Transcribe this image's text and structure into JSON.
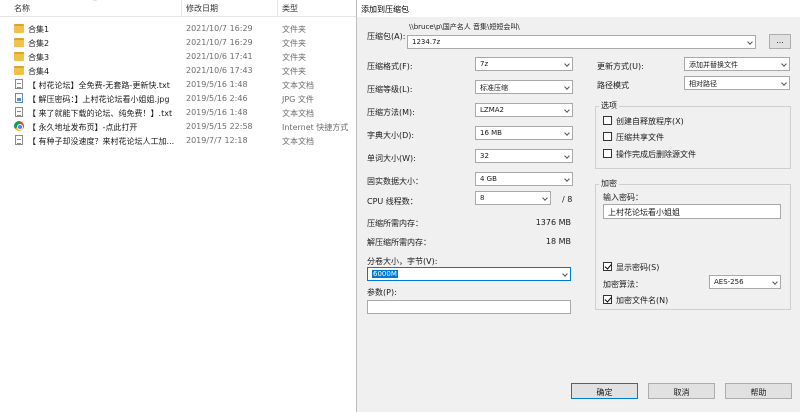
{
  "explorer": {
    "columns": {
      "name": "名称",
      "date": "修改日期",
      "type": "类型"
    },
    "files": [
      {
        "icon": "folder-icon",
        "name": "合集1",
        "date": "2021/10/7 16:29",
        "type": "文件夹"
      },
      {
        "icon": "folder-icon",
        "name": "合集2",
        "date": "2021/10/7 16:29",
        "type": "文件夹"
      },
      {
        "icon": "folder-icon",
        "name": "合集3",
        "date": "2021/10/6 17:41",
        "type": "文件夹"
      },
      {
        "icon": "folder-icon",
        "name": "合集4",
        "date": "2021/10/6 17:43",
        "type": "文件夹"
      },
      {
        "icon": "text-file-icon",
        "name": "【 村花论坛】全免费-无套路-更新快.txt",
        "date": "2019/5/16 1:48",
        "type": "文本文档"
      },
      {
        "icon": "image-file-icon",
        "name": "【 解压密码：】上村花论坛看小姐姐.jpg",
        "date": "2019/5/16 2:46",
        "type": "JPG 文件"
      },
      {
        "icon": "text-file-icon",
        "name": "【 来了就能下载的论坛、纯免费！】.txt",
        "date": "2019/5/16 1:48",
        "type": "文本文档"
      },
      {
        "icon": "chrome-icon",
        "name": "【 永久地址发布页】-点此打开",
        "date": "2019/5/15 22:58",
        "type": "Internet 快捷方式"
      },
      {
        "icon": "text-file-icon",
        "name": "【 有种子却没速度？来村花论坛人工加...",
        "date": "2019/7/7 12:18",
        "type": "文本文档"
      }
    ]
  },
  "dialog": {
    "title": "添加到压缩包",
    "archive_label": "压缩包(A):",
    "archive_path": "\\\\bruce\\p\\国产名人 音集\\短短会叫\\",
    "archive_name": "1234.7z",
    "browse_label": "...",
    "format_label": "压缩格式(F):",
    "format_value": "7z",
    "level_label": "压缩等级(L):",
    "level_value": "标准压缩",
    "method_label": "压缩方法(M):",
    "method_value": "LZMA2",
    "dict_label": "字典大小(D):",
    "dict_value": "16 MB",
    "word_label": "单词大小(W):",
    "word_value": "32",
    "solid_label": "固实数据大小：",
    "solid_value": "4 GB",
    "cpu_label": "CPU 线程数：",
    "cpu_value": "8",
    "cpu_total": "/ 8",
    "mem_comp_label": "压缩所需内存：",
    "mem_comp_value": "1376 MB",
    "mem_decomp_label": "解压缩所需内存：",
    "mem_decomp_value": "18 MB",
    "split_label": "分卷大小，字节(V):",
    "split_value": "6000M",
    "params_label": "参数(P):",
    "params_value": "",
    "update_label": "更新方式(U):",
    "update_value": "添加并替换文件",
    "path_label": "路径模式",
    "path_value": "相对路径",
    "options": {
      "title": "选项",
      "sfx": "创建自释放程序(X)",
      "shared": "压缩共享文件",
      "delete_after": "操作完成后删除源文件"
    },
    "encryption": {
      "title": "加密",
      "password_label": "输入密码：",
      "password_value": "上村花论坛看小姐姐",
      "show_password": "显示密码(S)",
      "method_label": "加密算法：",
      "method_value": "AES-256",
      "encrypt_names": "加密文件名(N)"
    },
    "buttons": {
      "ok": "确定",
      "cancel": "取消",
      "help": "帮助"
    }
  }
}
